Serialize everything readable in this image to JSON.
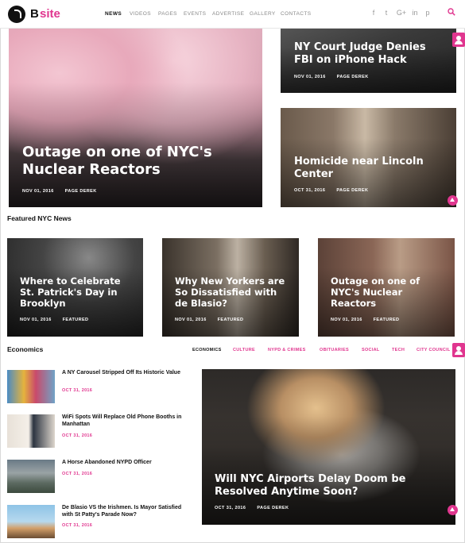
{
  "header": {
    "logo_letter": "B",
    "logo_text": "site",
    "nav": [
      "NEWS",
      "VIDEOS",
      "PAGES",
      "EVENTS",
      "ADVERTISE",
      "GALLERY",
      "CONTACTS"
    ],
    "social": [
      "f",
      "t",
      "G+",
      "in",
      "p"
    ]
  },
  "hero": {
    "main": {
      "title": "Outage on one of NYC's Nuclear Reactors",
      "date": "NOV 01, 2016",
      "author": "PAGE DEREK"
    },
    "top_right": {
      "title": "NY Court Judge Denies FBI on iPhone Hack",
      "date": "NOV 01, 2016",
      "author": "PAGE DEREK"
    },
    "bottom_right": {
      "title": "Homicide near Lincoln Center",
      "date": "OCT 31, 2016",
      "author": "PAGE DEREK"
    }
  },
  "featured": {
    "heading": "Featured NYC News",
    "cards": [
      {
        "title": "Where to Celebrate St. Patrick's Day in Brooklyn",
        "date": "NOV 01, 2016",
        "tag": "FEATURED"
      },
      {
        "title": "Why New Yorkers are So Dissatisfied with de Blasio?",
        "date": "NOV 01, 2016",
        "tag": "FEATURED"
      },
      {
        "title": "Outage on one of NYC's Nuclear Reactors",
        "date": "NOV 01, 2016",
        "tag": "FEATURED"
      }
    ]
  },
  "economics": {
    "heading": "Economics",
    "tabs": [
      "ECONOMICS",
      "CULTURE",
      "NYPD & CRIMES",
      "OBITUARIES",
      "SOCIAL",
      "TECH",
      "CITY COUNCIL"
    ],
    "list": [
      {
        "title": "A NY Carousel Stripped Off Its Historic Value",
        "date": "OCT 31, 2016"
      },
      {
        "title": "WiFi Spots Will Replace Old Phone Booths in Manhattan",
        "date": "OCT 31, 2016"
      },
      {
        "title": "A Horse Abandoned NYPD Officer",
        "date": "OCT 31, 2016"
      },
      {
        "title": "De Blasio VS the Irishmen. Is Mayor Satisfied with St Patty's Parade Now?",
        "date": "OCT 31, 2016"
      }
    ],
    "big": {
      "title": "Will NYC Airports Delay Doom be Resolved Anytime Soon?",
      "date": "OCT 31, 2016",
      "author": "PAGE DEREK"
    }
  },
  "colors": {
    "accent": "#e0368f",
    "text": "#111111"
  }
}
